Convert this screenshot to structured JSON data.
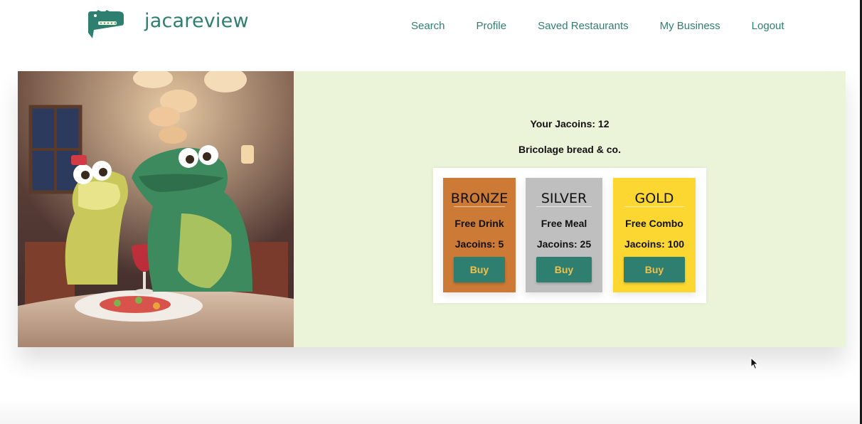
{
  "app": {
    "brand": "jacareview",
    "logo_icon": "alligator-logo-icon"
  },
  "nav": {
    "items": [
      {
        "label": "Search"
      },
      {
        "label": "Profile"
      },
      {
        "label": "Saved Restaurants"
      },
      {
        "label": "My Business"
      },
      {
        "label": "Logout"
      }
    ]
  },
  "rewards": {
    "coins_text": "Your Jacoins: 12",
    "restaurant_name": "Bricolage bread & co.",
    "tiers": [
      {
        "name": "BRONZE",
        "benefit": "Free Drink",
        "cost": "Jacoins: 5",
        "button": "Buy",
        "color": "#cc7a35"
      },
      {
        "name": "SILVER",
        "benefit": "Free Meal",
        "cost": "Jacoins: 25",
        "button": "Buy",
        "color": "#c0bfbf"
      },
      {
        "name": "GOLD",
        "benefit": "Free Combo",
        "cost": "Jacoins: 100",
        "button": "Buy",
        "color": "#fcd732"
      }
    ]
  },
  "colors": {
    "accent": "#2f7f70",
    "button_text": "#f0c14b",
    "panel_bg": "#ebf3d9"
  }
}
